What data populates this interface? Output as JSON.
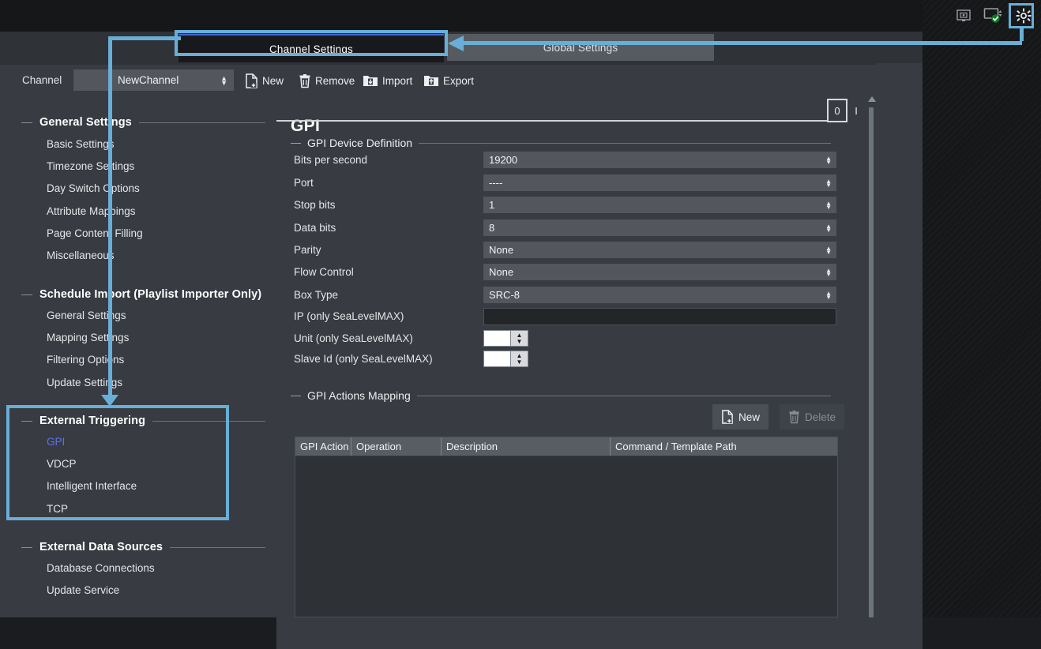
{
  "system_tray": {
    "icons": [
      {
        "name": "server-monitor-icon",
        "label": "Server Monitor"
      },
      {
        "name": "display-status-icon",
        "label": "Display Status OK"
      },
      {
        "name": "gear-icon",
        "label": "Settings"
      }
    ]
  },
  "tabs": [
    {
      "id": "channel-settings",
      "label": "Channel Settings",
      "active": true
    },
    {
      "id": "global-settings",
      "label": "Global Settings",
      "active": false
    }
  ],
  "toolbar": {
    "channel_label": "Channel",
    "channel_value": "NewChannel",
    "buttons": [
      {
        "id": "new",
        "label": "New",
        "icon": "new-file-icon"
      },
      {
        "id": "remove",
        "label": "Remove",
        "icon": "trash-icon"
      },
      {
        "id": "import",
        "label": "Import",
        "icon": "import-folder-icon"
      },
      {
        "id": "export",
        "label": "Export",
        "icon": "export-folder-icon"
      }
    ]
  },
  "sidebar": {
    "groups": [
      {
        "title": "General Settings",
        "items": [
          "Basic Settings",
          "Timezone Settings",
          "Day Switch Options",
          "Attribute Mappings",
          "Page Content Filling",
          "Miscellaneous"
        ]
      },
      {
        "title": "Schedule Import (Playlist Importer Only)",
        "items": [
          "General Settings",
          "Mapping Settings",
          "Filtering Options",
          "Update Settings"
        ]
      },
      {
        "title": "External Triggering",
        "items": [
          "GPI",
          "VDCP",
          "Intelligent Interface",
          "TCP"
        ],
        "active_item": "GPI"
      },
      {
        "title": "External Data Sources",
        "items": [
          "Database Connections",
          "Update Service"
        ]
      }
    ]
  },
  "panel": {
    "title": "GPI",
    "toggle_off_label": "0",
    "toggle_on_label": "I",
    "device_group_title": "GPI Device Definition",
    "fields": [
      {
        "label": "Bits per second",
        "value": "19200",
        "type": "combo"
      },
      {
        "label": "Port",
        "value": "----",
        "type": "combo"
      },
      {
        "label": "Stop bits",
        "value": "1",
        "type": "combo"
      },
      {
        "label": "Data bits",
        "value": "8",
        "type": "combo"
      },
      {
        "label": "Parity",
        "value": "None",
        "type": "combo"
      },
      {
        "label": "Flow Control",
        "value": "None",
        "type": "combo"
      },
      {
        "label": "Box Type",
        "value": "SRC-8",
        "type": "combo"
      },
      {
        "label": "IP (only SeaLevelMAX)",
        "value": "",
        "type": "text"
      },
      {
        "label": "Unit (only SeaLevelMAX)",
        "value": "",
        "type": "spinner"
      },
      {
        "label": "Slave Id (only SeaLevelMAX)",
        "value": "",
        "type": "spinner"
      }
    ],
    "actions_group_title": "GPI Actions Mapping",
    "new_button_label": "New",
    "delete_button_label": "Delete",
    "table": {
      "columns": [
        "GPI Action",
        "Operation",
        "Description",
        "Command / Template Path"
      ],
      "rows": []
    }
  },
  "annotations": {
    "highlight_color": "#69aed6",
    "boxes": [
      "channel-settings-tab",
      "external-triggering-group",
      "gear-icon"
    ]
  }
}
